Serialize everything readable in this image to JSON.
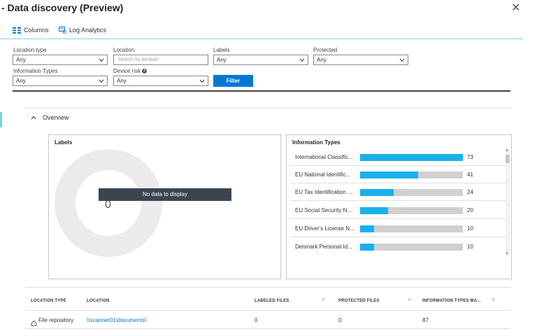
{
  "window": {
    "title": "- Data discovery (Preview)",
    "close_glyph": "✕"
  },
  "toolbar": {
    "columns_label": "Columns",
    "log_analytics_label": "Log Analytics"
  },
  "filters": {
    "location_type": {
      "label": "Location type",
      "value": "Any"
    },
    "location": {
      "label": "Location",
      "placeholder": "Search by location"
    },
    "labels": {
      "label": "Labels",
      "value": "Any"
    },
    "protected": {
      "label": "Protected",
      "value": "Any"
    },
    "information_types": {
      "label": "Information Types",
      "value": "Any"
    },
    "device_risk": {
      "label": "Device risk",
      "value": "Any"
    },
    "filter_button": "Filter"
  },
  "overview": {
    "label": "Overview",
    "labels_card": {
      "title": "Labels",
      "center_value": "0",
      "no_data": "No data to display"
    },
    "info_types_card": {
      "title": "Information Types",
      "max_value": 73,
      "bar_color": "#1ab1ea",
      "track_color": "#d2d0ce",
      "rows": [
        {
          "name": "International Classific...",
          "value": 73
        },
        {
          "name": "EU National Identific...",
          "value": 41
        },
        {
          "name": "EU Tax Identification ...",
          "value": 24
        },
        {
          "name": "EU Social Security N...",
          "value": 20
        },
        {
          "name": "EU Driver's License N...",
          "value": 10
        },
        {
          "name": "Denmark Personal Id...",
          "value": 10
        }
      ]
    }
  },
  "table": {
    "columns": [
      "LOCATION TYPE",
      "LOCATION",
      "LABELED FILES",
      "PROTECTED FILES",
      "INFORMATION TYPES MA..."
    ],
    "rows": [
      {
        "location_type": "File repository",
        "location": "\\\\scanner01\\documents\\",
        "labeled_files": "0",
        "protected_files": "0",
        "info_types_matched": "87"
      }
    ]
  },
  "colors": {
    "accent": "#0078d4",
    "bar": "#1ab1ea",
    "no_data_bg": "#3b4550"
  }
}
